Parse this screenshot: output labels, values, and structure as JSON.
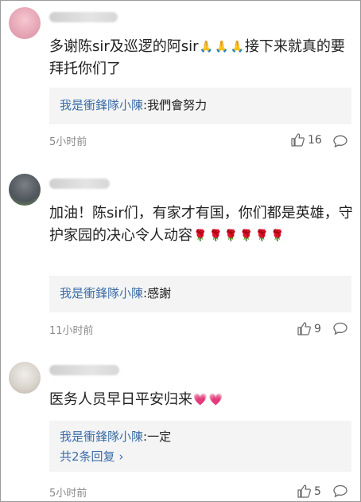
{
  "comments": [
    {
      "text": "多谢陈sir及巡逻的阿sir",
      "text_tail": "接下来就真的要拜托你们了",
      "emoji": [
        "🙏",
        "🙏",
        "🙏"
      ],
      "reply_author": "我是衝鋒隊小陳",
      "reply_sep": ":",
      "reply_text": "我們會努力",
      "time": "5小时前",
      "likes": "16"
    },
    {
      "text": "加油！陈sir们，有家才有国，你们都是英雄，守护家园的决心令人动容",
      "emoji": [
        "🌹",
        "🌹",
        "🌹",
        "🌹",
        "🌹",
        "🌹"
      ],
      "reply_author": "我是衝鋒隊小陳",
      "reply_sep": ":",
      "reply_text": "感謝",
      "time": "11小时前",
      "likes": "9"
    },
    {
      "text": "医务人员早日平安归来",
      "emoji": [
        "💗",
        "💗"
      ],
      "reply_author": "我是衝鋒隊小陳",
      "reply_sep": ":",
      "reply_text": "一定",
      "more_replies": "共2条回复",
      "more_arrow": "›",
      "time": "5小时前",
      "likes": "5"
    }
  ],
  "icons": {
    "like": "thumbs-up-icon",
    "comment": "comment-bubble-icon"
  },
  "colors": {
    "link": "#3d6ea8",
    "reply_bg": "#f4f4f4",
    "meta": "#8a8a8a"
  }
}
